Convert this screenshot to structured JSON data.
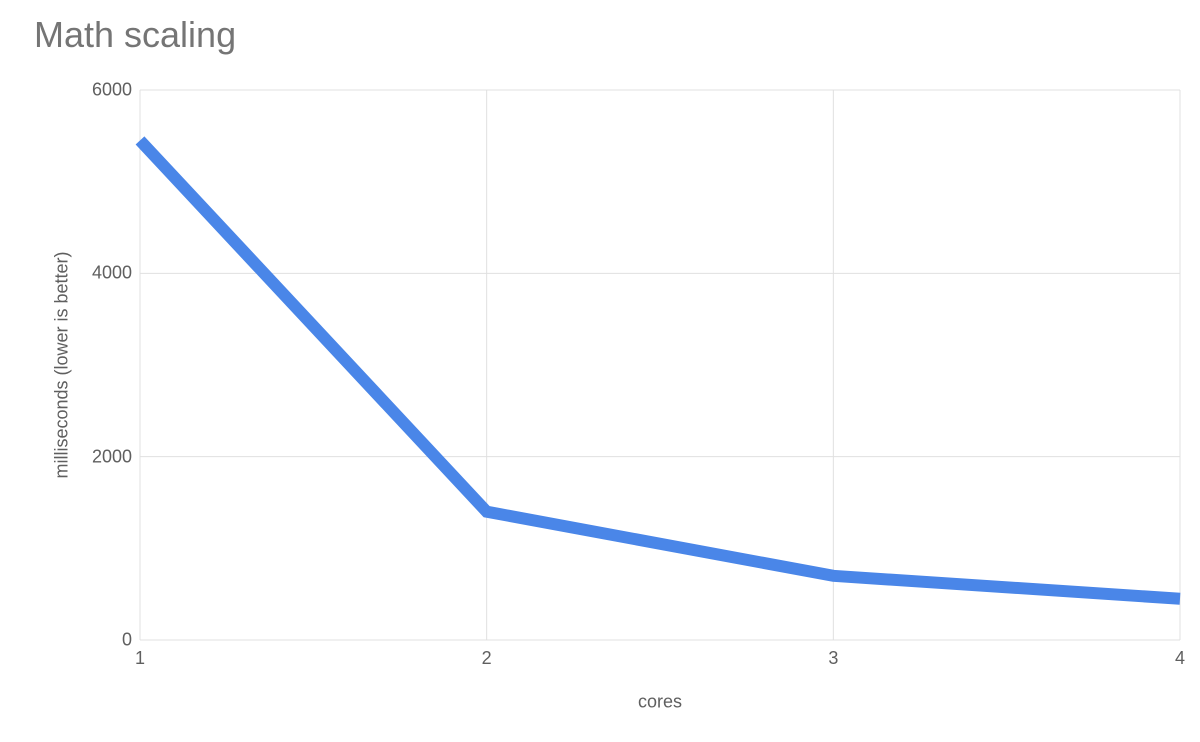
{
  "chart_data": {
    "type": "line",
    "title": "Math scaling",
    "xlabel": "cores",
    "ylabel": "milliseconds (lower is better)",
    "x": [
      1,
      2,
      3,
      4
    ],
    "values": [
      5450,
      1400,
      700,
      450
    ],
    "ylim": [
      0,
      6000
    ],
    "y_ticks": [
      0,
      2000,
      4000,
      6000
    ],
    "x_ticks": [
      1,
      2,
      3,
      4
    ],
    "line_color": "#4a86e8"
  }
}
